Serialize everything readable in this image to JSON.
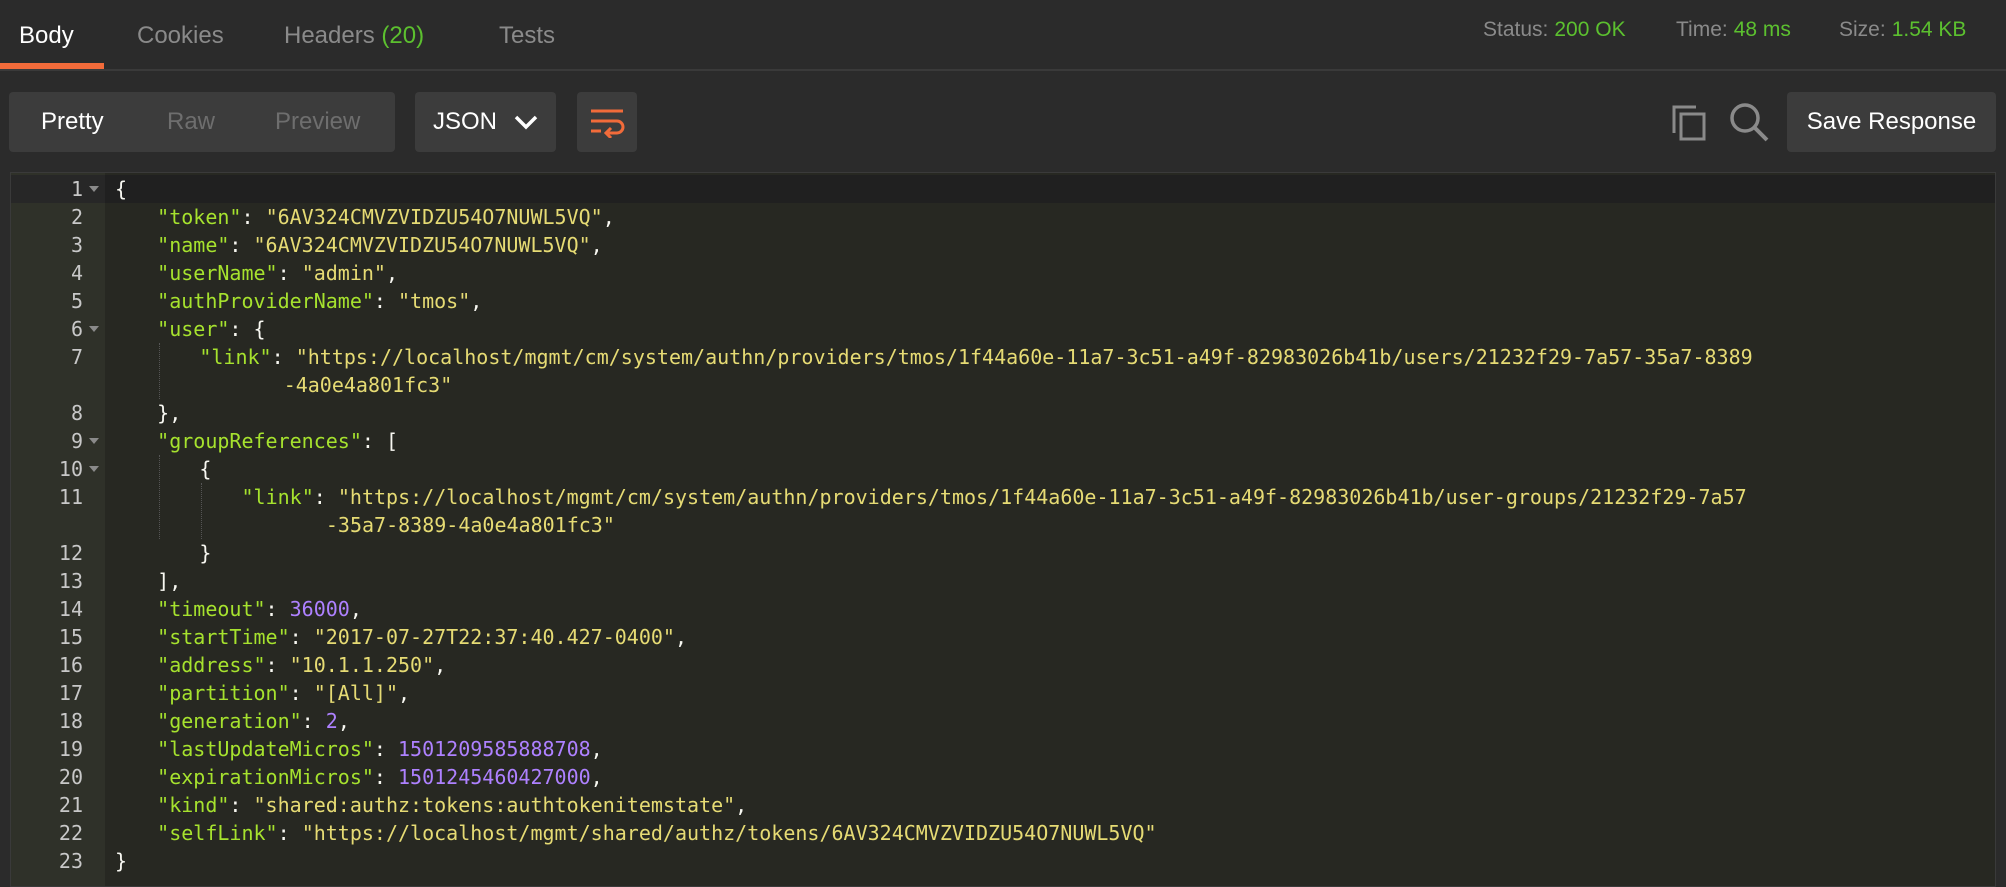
{
  "tabs": [
    {
      "label": "Body",
      "active": true
    },
    {
      "label": "Cookies",
      "active": false
    },
    {
      "label": "Headers",
      "count": "(20)",
      "active": false
    },
    {
      "label": "Tests",
      "active": false
    }
  ],
  "status": {
    "status_label": "Status:",
    "status_value": "200 OK",
    "time_label": "Time:",
    "time_value": "48 ms",
    "size_label": "Size:",
    "size_value": "1.54 KB"
  },
  "toolbar": {
    "view_modes": [
      {
        "label": "Pretty",
        "active": true
      },
      {
        "label": "Raw",
        "active": false
      },
      {
        "label": "Preview",
        "active": false
      }
    ],
    "format": "JSON",
    "save_label": "Save Response",
    "icons": [
      "wrap-lines-icon",
      "copy-icon",
      "search-icon"
    ]
  },
  "colors": {
    "accent": "#f26b3a",
    "status_ok": "#5cc02f",
    "json_key": "#a6e22e",
    "json_string": "#e6db74",
    "json_number": "#ae81ff"
  },
  "code_lines": [
    {
      "num": "1",
      "text": "{"
    },
    {
      "num": "2",
      "key": "\"token\"",
      "value": "\"6AV324CMVZVIDZU54O7NUWL5VQ\"",
      "suffix": ","
    },
    {
      "num": "3",
      "key": "\"name\"",
      "value": "\"6AV324CMVZVIDZU54O7NUWL5VQ\"",
      "suffix": ","
    },
    {
      "num": "4",
      "key": "\"userName\"",
      "value": "\"admin\"",
      "suffix": ","
    },
    {
      "num": "5",
      "key": "\"authProviderName\"",
      "value": "\"tmos\"",
      "suffix": ","
    },
    {
      "num": "6",
      "key": "\"user\"",
      "value": "{",
      "suffix": ""
    },
    {
      "num": "7",
      "key": "\"link\"",
      "value": "\"https://localhost/mgmt/cm/system/authn/providers/tmos/1f44a60e-11a7-3c51-a49f-82983026b41b/users/21232f29-7a57-35a7-8389",
      "suffix": ""
    },
    {
      "num": "",
      "value": "-4a0e4a801fc3\""
    },
    {
      "num": "8",
      "text": "},"
    },
    {
      "num": "9",
      "key": "\"groupReferences\"",
      "value": "[",
      "suffix": ""
    },
    {
      "num": "10",
      "text": "{"
    },
    {
      "num": "11",
      "key": "\"link\"",
      "value": "\"https://localhost/mgmt/cm/system/authn/providers/tmos/1f44a60e-11a7-3c51-a49f-82983026b41b/user-groups/21232f29-7a57",
      "suffix": ""
    },
    {
      "num": "",
      "value": "-35a7-8389-4a0e4a801fc3\""
    },
    {
      "num": "12",
      "text": "}"
    },
    {
      "num": "13",
      "text": "],"
    },
    {
      "num": "14",
      "key": "\"timeout\"",
      "value": "36000",
      "suffix": ","
    },
    {
      "num": "15",
      "key": "\"startTime\"",
      "value": "\"2017-07-27T22:37:40.427-0400\"",
      "suffix": ","
    },
    {
      "num": "16",
      "key": "\"address\"",
      "value": "\"10.1.1.250\"",
      "suffix": ","
    },
    {
      "num": "17",
      "key": "\"partition\"",
      "value": "\"[All]\"",
      "suffix": ","
    },
    {
      "num": "18",
      "key": "\"generation\"",
      "value": "2",
      "suffix": ","
    },
    {
      "num": "19",
      "key": "\"lastUpdateMicros\"",
      "value": "1501209585888708",
      "suffix": ","
    },
    {
      "num": "20",
      "key": "\"expirationMicros\"",
      "value": "1501245460427000",
      "suffix": ","
    },
    {
      "num": "21",
      "key": "\"kind\"",
      "value": "\"shared:authz:tokens:authtokenitemstate\"",
      "suffix": ","
    },
    {
      "num": "22",
      "key": "\"selfLink\"",
      "value": "\"https://localhost/mgmt/shared/authz/tokens/6AV324CMVZVIDZU54O7NUWL5VQ\"",
      "suffix": ""
    },
    {
      "num": "23",
      "text": "}"
    }
  ]
}
